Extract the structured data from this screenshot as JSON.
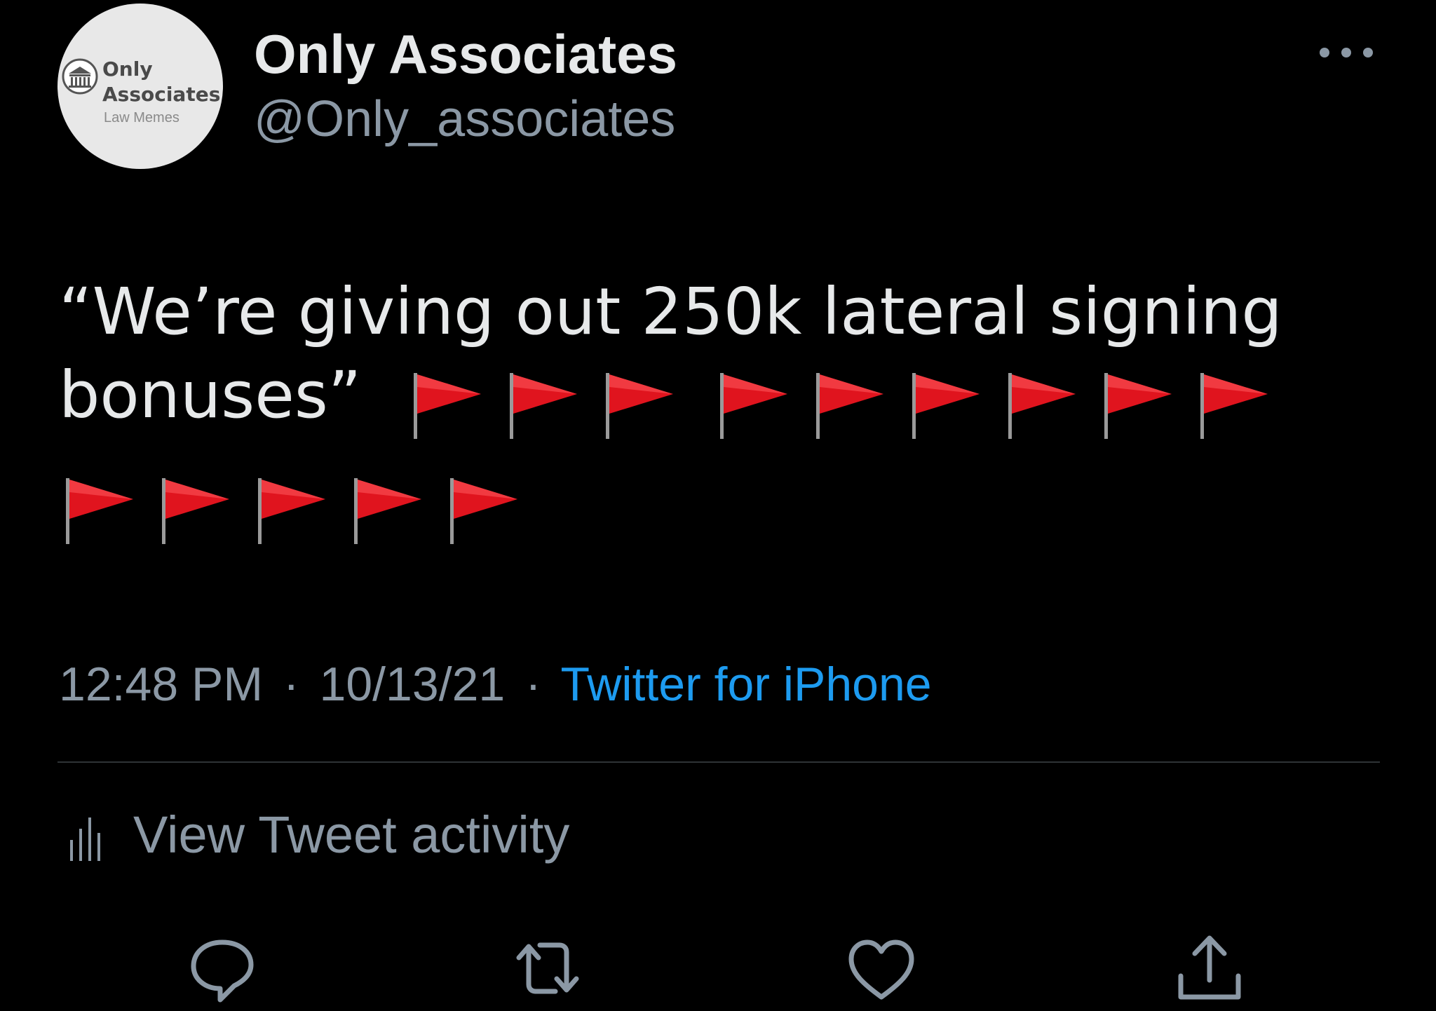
{
  "author": {
    "display_name": "Only Associates",
    "handle": "@Only_associates",
    "avatar": {
      "line1": "Only",
      "line2": "Associates",
      "line3": "Law Memes",
      "icon": "courthouse-icon"
    }
  },
  "more_icon": "more-options-icon",
  "tweet": {
    "text_line1": "“We’re giving out 250k lateral signing",
    "text_line2": "bonuses”",
    "emoji": "🚩",
    "emoji_count_line2": 9,
    "emoji_count_line3": 5
  },
  "meta": {
    "time": "12:48 PM",
    "separator": "·",
    "date": "10/13/21",
    "source": "Twitter for iPhone"
  },
  "activity": {
    "label": "View Tweet activity",
    "icon": "bar-chart-icon"
  },
  "actions": [
    {
      "name": "reply",
      "icon": "reply-icon"
    },
    {
      "name": "retweet",
      "icon": "retweet-icon"
    },
    {
      "name": "like",
      "icon": "heart-icon"
    },
    {
      "name": "share",
      "icon": "share-icon"
    }
  ],
  "colors": {
    "background": "#000000",
    "primary_text": "#e7e9ea",
    "secondary_text": "#8b98a5",
    "link": "#1d9bf0",
    "divider": "#2f3336",
    "flag_red": "#e0141e"
  }
}
